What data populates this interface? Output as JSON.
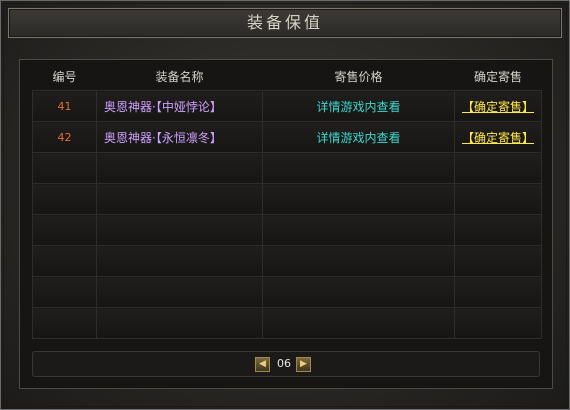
{
  "window": {
    "title": "装备保值"
  },
  "table": {
    "headers": [
      "编号",
      "装备名称",
      "寄售价格",
      "确定寄售"
    ],
    "rows": [
      {
        "num": "41",
        "name": "奥恩神器·【中娅悖论】",
        "price": "详情游戏内查看",
        "action": "【确定寄售】"
      },
      {
        "num": "42",
        "name": "奥恩神器·【永恒凛冬】",
        "price": "详情游戏内查看",
        "action": "【确定寄售】"
      }
    ],
    "empty_rows": 6
  },
  "pager": {
    "page": "06",
    "prev_icon": "arrow-left-icon",
    "next_icon": "arrow-right-icon"
  },
  "colors": {
    "num": "#e06d33",
    "name": "#cfa0ff",
    "price": "#3fd8d0",
    "action": "#ffe84a"
  }
}
